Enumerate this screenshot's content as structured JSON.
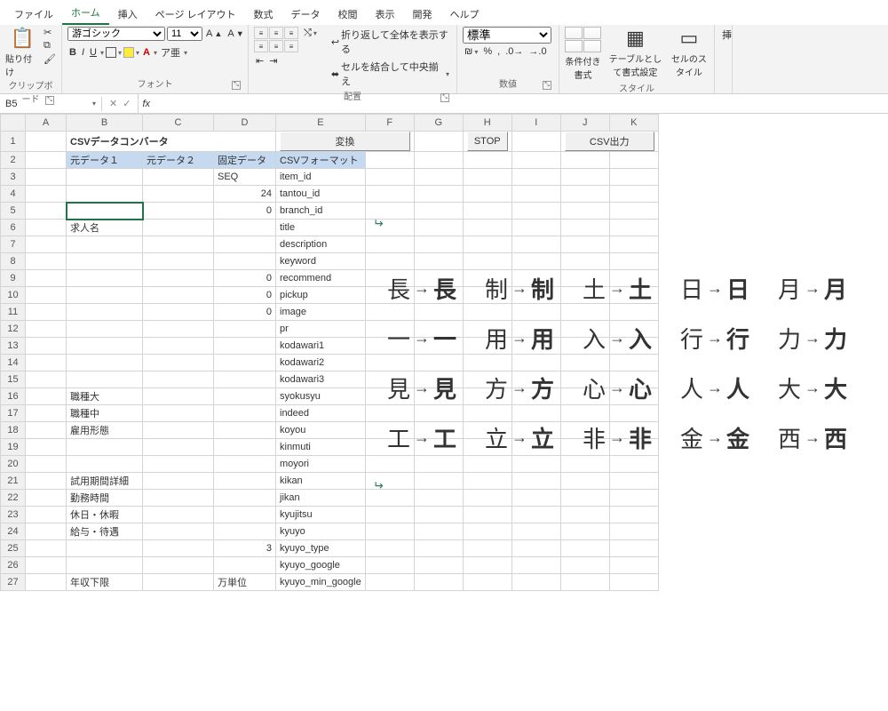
{
  "menu": {
    "items": [
      "ファイル",
      "ホーム",
      "挿入",
      "ページ レイアウト",
      "数式",
      "データ",
      "校閲",
      "表示",
      "開発",
      "ヘルプ"
    ],
    "active": 1
  },
  "ribbon": {
    "clipboard": {
      "paste": "貼り付け",
      "label": "クリップボード"
    },
    "font": {
      "name": "游ゴシック",
      "size": "11",
      "bold": "B",
      "italic": "I",
      "underline": "U",
      "increase": "A▲",
      "decrease": "A▼",
      "label": "フォント"
    },
    "alignment": {
      "wrap": "折り返して全体を表示する",
      "merge": "セルを結合して中央揃え",
      "label": "配置"
    },
    "number": {
      "format": "標準",
      "label": "数値"
    },
    "styles": {
      "cond": "条件付き書式",
      "table": "テーブルとして書式設定",
      "cell": "セルのスタイル",
      "label": "スタイル"
    }
  },
  "formula_bar": {
    "namebox": "B5",
    "fx": "fx"
  },
  "sheet": {
    "columns": [
      "A",
      "B",
      "C",
      "D",
      "E",
      "F",
      "G",
      "H",
      "I",
      "J",
      "K"
    ],
    "title": "CSVデータコンバータ",
    "buttons": {
      "convert": "変換",
      "stop": "STOP",
      "csv": "CSV出力"
    },
    "headers": {
      "b": "元データ１",
      "c": "元データ２",
      "d": "固定データ",
      "e": "CSVフォーマット"
    },
    "active_cell": "B5",
    "rows": [
      {
        "n": 3,
        "b": "",
        "d": "SEQ",
        "e": "item_id"
      },
      {
        "n": 4,
        "b": "",
        "d": "24",
        "d_num": true,
        "e": "tantou_id"
      },
      {
        "n": 5,
        "b": "",
        "d": "0",
        "d_num": true,
        "e": "branch_id"
      },
      {
        "n": 6,
        "b": "求人名",
        "d": "",
        "e": "title"
      },
      {
        "n": 7,
        "b": "",
        "d": "",
        "e": "description"
      },
      {
        "n": 8,
        "b": "",
        "d": "",
        "e": "keyword"
      },
      {
        "n": 9,
        "b": "",
        "d": "0",
        "d_num": true,
        "e": "recommend"
      },
      {
        "n": 10,
        "b": "",
        "d": "0",
        "d_num": true,
        "e": "pickup"
      },
      {
        "n": 11,
        "b": "",
        "d": "0",
        "d_num": true,
        "e": "image"
      },
      {
        "n": 12,
        "b": "",
        "d": "",
        "e": "pr"
      },
      {
        "n": 13,
        "b": "",
        "d": "",
        "e": "kodawari1"
      },
      {
        "n": 14,
        "b": "",
        "d": "",
        "e": "kodawari2"
      },
      {
        "n": 15,
        "b": "",
        "d": "",
        "e": "kodawari3"
      },
      {
        "n": 16,
        "b": "職種大",
        "d": "",
        "e": "syokusyu"
      },
      {
        "n": 17,
        "b": "職種中",
        "d": "",
        "e": "indeed"
      },
      {
        "n": 18,
        "b": "雇用形態",
        "d": "",
        "e": "koyou"
      },
      {
        "n": 19,
        "b": "",
        "d": "",
        "e": "kinmuti"
      },
      {
        "n": 20,
        "b": "",
        "d": "",
        "e": "moyori"
      },
      {
        "n": 21,
        "b": "試用期間詳細",
        "d": "",
        "e": "kikan"
      },
      {
        "n": 22,
        "b": "勤務時間",
        "d": "",
        "e": "jikan"
      },
      {
        "n": 23,
        "b": "休日・休暇",
        "d": "",
        "e": "kyujitsu"
      },
      {
        "n": 24,
        "b": "給与・待遇",
        "d": "",
        "e": "kyuyo"
      },
      {
        "n": 25,
        "b": "",
        "d": "3",
        "d_num": true,
        "e": "kyuyo_type"
      },
      {
        "n": 26,
        "b": "",
        "d": "",
        "e": "kyuyo_google"
      },
      {
        "n": 27,
        "b": "年収下限",
        "d": "万単位",
        "e": "kyuyo_min_google"
      }
    ]
  },
  "kanji_pairs": [
    [
      "長",
      "長"
    ],
    [
      "制",
      "制"
    ],
    [
      "土",
      "土"
    ],
    [
      "日",
      "日"
    ],
    [
      "月",
      "月"
    ],
    [
      "一",
      "一"
    ],
    [
      "用",
      "用"
    ],
    [
      "入",
      "入"
    ],
    [
      "行",
      "行"
    ],
    [
      "力",
      "力"
    ],
    [
      "見",
      "見"
    ],
    [
      "方",
      "方"
    ],
    [
      "心",
      "心"
    ],
    [
      "人",
      "人"
    ],
    [
      "大",
      "大"
    ],
    [
      "工",
      "工"
    ],
    [
      "立",
      "立"
    ],
    [
      "非",
      "非"
    ],
    [
      "金",
      "金"
    ],
    [
      "西",
      "西"
    ]
  ]
}
